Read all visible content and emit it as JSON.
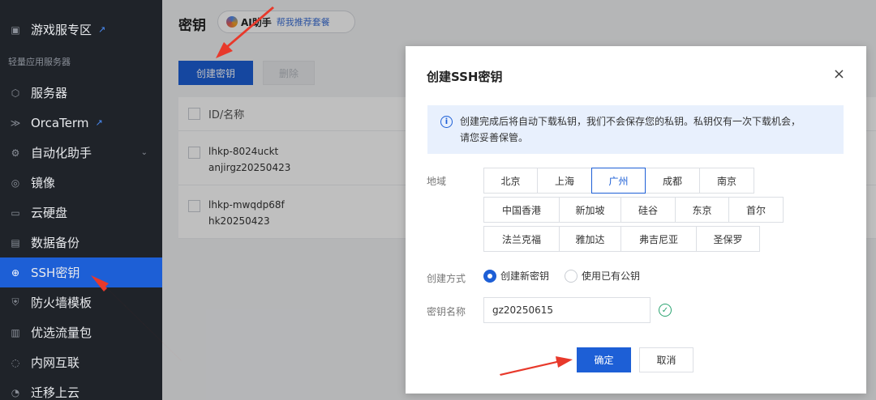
{
  "sidebar": {
    "items": [
      {
        "label": "游戏服专区",
        "icon": "game-server-icon",
        "external": true
      },
      {
        "label": "服务器",
        "icon": "server-icon"
      },
      {
        "label": "OrcaTerm",
        "icon": "terminal-icon",
        "external": true
      },
      {
        "label": "自动化助手",
        "icon": "automation-icon",
        "expandable": true
      },
      {
        "label": "镜像",
        "icon": "image-icon"
      },
      {
        "label": "云硬盘",
        "icon": "disk-icon"
      },
      {
        "label": "数据备份",
        "icon": "backup-icon"
      },
      {
        "label": "SSH密钥",
        "icon": "key-icon",
        "active": true
      },
      {
        "label": "防火墙模板",
        "icon": "firewall-icon"
      },
      {
        "label": "优选流量包",
        "icon": "traffic-icon"
      },
      {
        "label": "内网互联",
        "icon": "network-icon"
      },
      {
        "label": "迁移上云",
        "icon": "migrate-icon"
      }
    ],
    "section_label": "轻量应用服务器"
  },
  "main": {
    "title": "密钥",
    "ai_label": "AI助手",
    "ai_subtitle": "帮我推荐套餐",
    "create_button": "创建密钥",
    "delete_button": "删除",
    "table": {
      "header": "ID/名称",
      "rows": [
        {
          "id": "lhkp-8024uckt",
          "name": "anjirgz20250423"
        },
        {
          "id": "lhkp-mwqdp68f",
          "name": "hk20250423"
        }
      ]
    }
  },
  "modal": {
    "title": "创建SSH密钥",
    "close": "×",
    "notice_line1": "创建完成后将自动下载私钥，我们不会保存您的私钥。私钥仅有一次下载机会，",
    "notice_line2": "请您妥善保管。",
    "region_label": "地域",
    "regions": [
      "北京",
      "上海",
      "广州",
      "成都",
      "南京",
      "中国香港",
      "新加坡",
      "硅谷",
      "东京",
      "首尔",
      "法兰克福",
      "雅加达",
      "弗吉尼亚",
      "圣保罗"
    ],
    "selected_region": "广州",
    "method_label": "创建方式",
    "method_options": [
      "创建新密钥",
      "使用已有公钥"
    ],
    "selected_method": "创建新密钥",
    "name_label": "密钥名称",
    "name_value": "gz20250615",
    "confirm_button": "确定",
    "cancel_button": "取消"
  },
  "colors": {
    "primary": "#1d5fd6",
    "sidebar_bg": "#1f2329",
    "annotation_arrow": "#e8392b",
    "success": "#2ba471"
  }
}
